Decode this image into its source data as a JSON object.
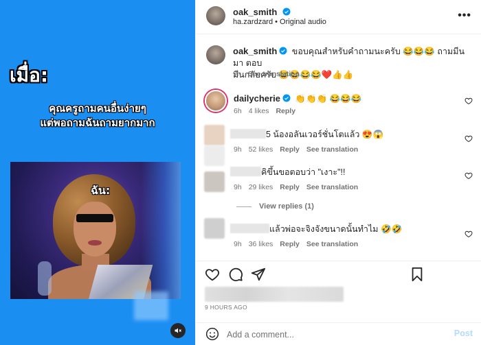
{
  "media": {
    "heading": "เมื่อ:",
    "caption_line1": "คุณครูถามคนอื่นง่ายๆ",
    "caption_line2": "แต่พอถามฉันถามยากมาก",
    "frame_label": "ฉัน:",
    "mute_icon": "muted-speaker-icon"
  },
  "post": {
    "author": "oak_smith",
    "audio_line": "ha.zardzard • Original audio",
    "more_icon": "•••"
  },
  "comments": [
    {
      "username": "oak_smith",
      "text_line1": "ขอบคุณสำหรับคำถามนะครับ 😂😂😂 ถามมีนมา ตอบ",
      "text_line2": "มีนกลับครับ 😂😂😂😂❤️👍👍",
      "time": "9h",
      "see_translation": "See translation"
    },
    {
      "username": "dailycherie",
      "text": "👏👏👏 😂😂😂",
      "time": "6h",
      "likes": "4 likes",
      "reply": "Reply"
    },
    {
      "text": "5 น้องอลันเวอร์ชั่นโตแล้ว 😍😱",
      "time": "9h",
      "likes": "52 likes",
      "reply": "Reply",
      "see_translation": "See translation"
    },
    {
      "text": "คิขึ้นขอตอบว่า \"เงาะ\"!!",
      "time": "9h",
      "likes": "29 likes",
      "reply": "Reply",
      "see_translation": "See translation"
    },
    {
      "text": "แล้วพ่อจะจิงจังขนาดนั้นทำไม 🤣🤣",
      "time": "9h",
      "likes": "36 likes",
      "reply": "Reply",
      "see_translation": "See translation"
    }
  ],
  "view_replies": "View replies (1)",
  "time_ago": "9 HOURS AGO",
  "add_comment": {
    "placeholder": "Add a comment...",
    "post_label": "Post"
  },
  "colors": {
    "media_bg": "#1b8ef2",
    "verified": "#0095f6",
    "post_disabled": "#b3dbff",
    "secondary_text": "#737373"
  }
}
